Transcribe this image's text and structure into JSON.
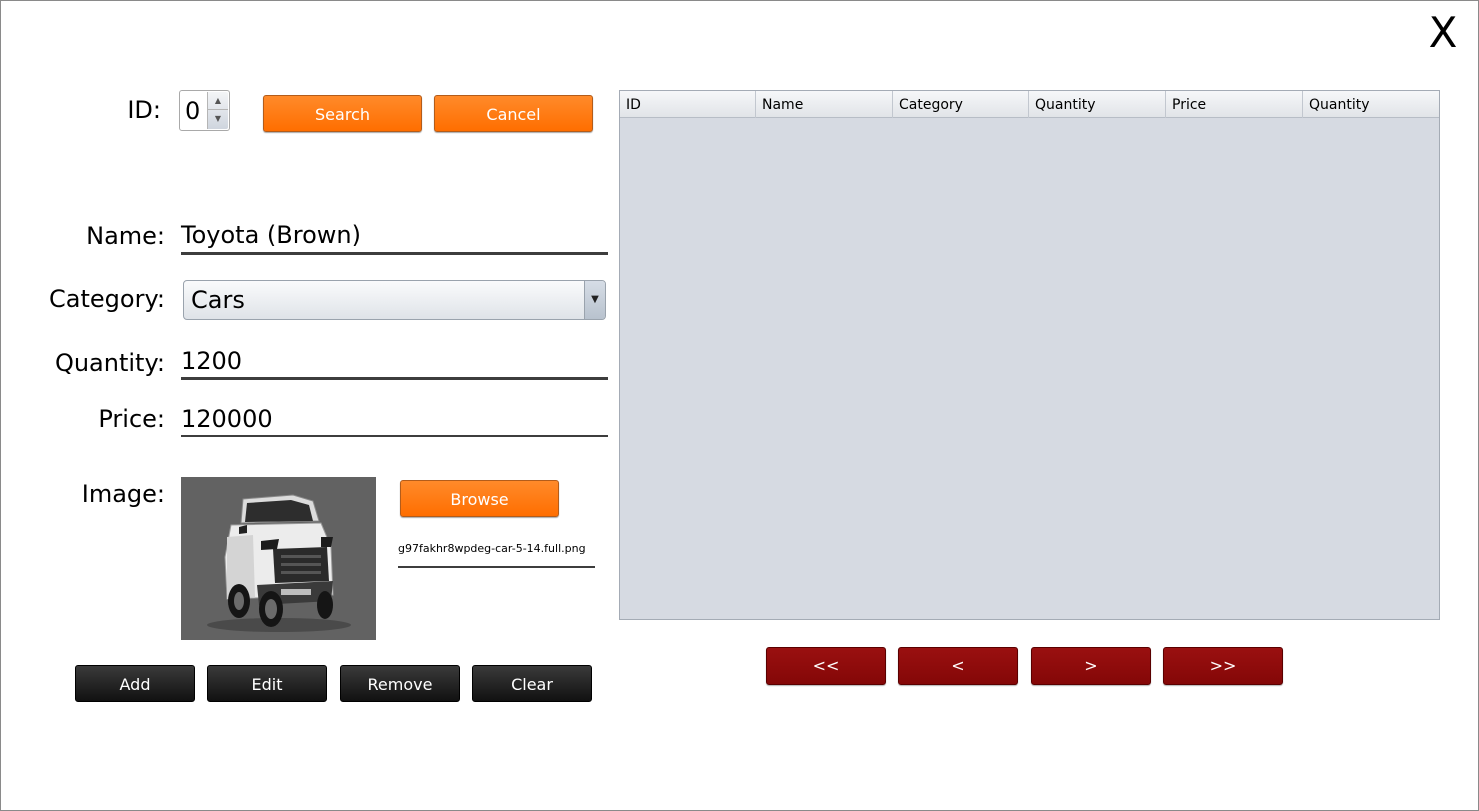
{
  "window": {
    "close_label": "X"
  },
  "form": {
    "id_label": "ID:",
    "id_value": "0",
    "search_label": "Search",
    "cancel_label": "Cancel",
    "name_label": "Name:",
    "name_value": "Toyota (Brown)",
    "category_label": "Category:",
    "category_value": "Cars",
    "quantity_label": "Quantity:",
    "quantity_value": "1200",
    "price_label": "Price:",
    "price_value": "120000",
    "image_label": "Image:",
    "browse_label": "Browse",
    "image_filename": "g97fakhr8wpdeg-car-5-14.full.png"
  },
  "actions": {
    "add_label": "Add",
    "edit_label": "Edit",
    "remove_label": "Remove",
    "clear_label": "Clear"
  },
  "table": {
    "columns": [
      "ID",
      "Name",
      "Category",
      "Quantity",
      "Price",
      "Quantity"
    ],
    "rows": []
  },
  "pagination": {
    "first_label": "<<",
    "prev_label": "<",
    "next_label": ">",
    "last_label": ">>"
  },
  "colors": {
    "accent_orange": "#ff7516",
    "nav_red": "#8b0a0a",
    "action_black": "#222222",
    "table_bg": "#d6dae2"
  }
}
